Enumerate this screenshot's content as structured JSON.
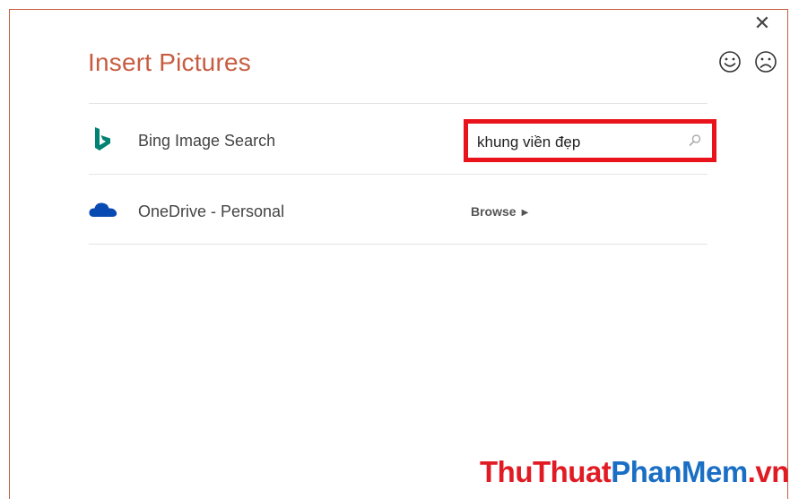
{
  "dialog": {
    "title": "Insert Pictures",
    "close_glyph": "✕",
    "feedback": {
      "smile_icon": "smile-icon",
      "frown_icon": "frown-icon"
    }
  },
  "sources": {
    "bing": {
      "label": "Bing Image Search",
      "icon": "bing-icon",
      "search_value": "khung viền đẹp",
      "icon_color": "#008373"
    },
    "onedrive": {
      "label": "OneDrive - Personal",
      "icon": "onedrive-icon",
      "browse_label": "Browse",
      "icon_color": "#094ab2"
    }
  },
  "watermark": {
    "part1": "ThuThuat",
    "part2": "PhanMem",
    "part3": ".vn"
  },
  "colors": {
    "accent": "#c75d40",
    "highlight_border": "#e8131b"
  }
}
